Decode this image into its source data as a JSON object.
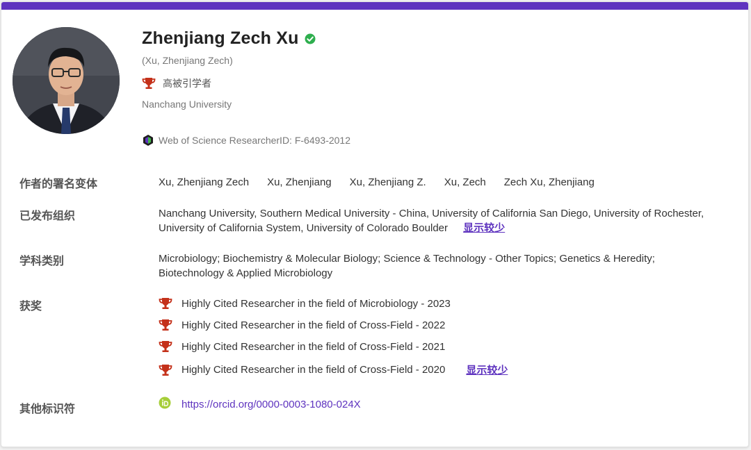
{
  "profile": {
    "name": "Zhenjiang Zech Xu",
    "alt_name": "(Xu, Zhenjiang Zech)",
    "highly_cited": "高被引学者",
    "affiliation": "Nanchang University",
    "wos_id": "Web of Science ResearcherID: F-6493-2012"
  },
  "details": {
    "variants_label": "作者的署名变体",
    "variants": [
      "Xu, Zhenjiang Zech",
      "Xu, Zhenjiang",
      "Xu, Zhenjiang Z.",
      "Xu, Zech",
      "Zech Xu, Zhenjiang"
    ],
    "orgs_label": "已发布组织",
    "orgs_line1": "Nanchang University,  Southern Medical University - China,  University of California San Diego,  University of Rochester,",
    "orgs_line2": "University of California System,  University of Colorado Boulder",
    "subjects_label": "学科类别",
    "subjects_line1": "Microbiology;  Biochemistry & Molecular Biology;  Science & Technology - Other Topics;  Genetics & Heredity;",
    "subjects_line2": "Biotechnology & Applied Microbiology",
    "awards_label": "获奖",
    "awards": [
      "Highly Cited Researcher in the field of Microbiology - 2023",
      "Highly Cited Researcher in the field of Cross-Field - 2022",
      "Highly Cited Researcher in the field of Cross-Field - 2021",
      "Highly Cited Researcher in the field of Cross-Field - 2020"
    ],
    "identifiers_label": "其他标识符",
    "orcid_url": "https://orcid.org/0000-0003-1080-024X",
    "show_less": "显示较少"
  },
  "colors": {
    "accent": "#5e33bf",
    "trophy": "#c4311a",
    "verified": "#2eae4e",
    "orcid": "#a6ce39"
  },
  "icons": {
    "verified": "check-circle-icon",
    "trophy": "trophy-icon",
    "wos": "web-of-science-logo",
    "orcid": "orcid-icon"
  }
}
